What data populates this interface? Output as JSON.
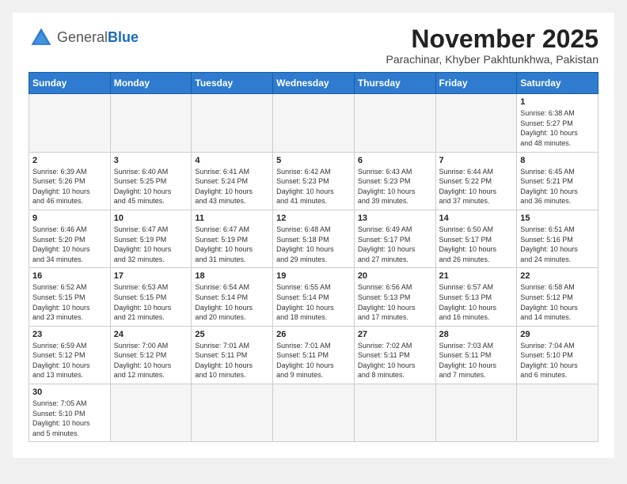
{
  "header": {
    "logo_general": "General",
    "logo_blue": "Blue",
    "month_title": "November 2025",
    "subtitle": "Parachinar, Khyber Pakhtunkhwa, Pakistan"
  },
  "weekdays": [
    "Sunday",
    "Monday",
    "Tuesday",
    "Wednesday",
    "Thursday",
    "Friday",
    "Saturday"
  ],
  "weeks": [
    [
      {
        "day": "",
        "info": ""
      },
      {
        "day": "",
        "info": ""
      },
      {
        "day": "",
        "info": ""
      },
      {
        "day": "",
        "info": ""
      },
      {
        "day": "",
        "info": ""
      },
      {
        "day": "",
        "info": ""
      },
      {
        "day": "1",
        "info": "Sunrise: 6:38 AM\nSunset: 5:27 PM\nDaylight: 10 hours\nand 48 minutes."
      }
    ],
    [
      {
        "day": "2",
        "info": "Sunrise: 6:39 AM\nSunset: 5:26 PM\nDaylight: 10 hours\nand 46 minutes."
      },
      {
        "day": "3",
        "info": "Sunrise: 6:40 AM\nSunset: 5:25 PM\nDaylight: 10 hours\nand 45 minutes."
      },
      {
        "day": "4",
        "info": "Sunrise: 6:41 AM\nSunset: 5:24 PM\nDaylight: 10 hours\nand 43 minutes."
      },
      {
        "day": "5",
        "info": "Sunrise: 6:42 AM\nSunset: 5:23 PM\nDaylight: 10 hours\nand 41 minutes."
      },
      {
        "day": "6",
        "info": "Sunrise: 6:43 AM\nSunset: 5:23 PM\nDaylight: 10 hours\nand 39 minutes."
      },
      {
        "day": "7",
        "info": "Sunrise: 6:44 AM\nSunset: 5:22 PM\nDaylight: 10 hours\nand 37 minutes."
      },
      {
        "day": "8",
        "info": "Sunrise: 6:45 AM\nSunset: 5:21 PM\nDaylight: 10 hours\nand 36 minutes."
      }
    ],
    [
      {
        "day": "9",
        "info": "Sunrise: 6:46 AM\nSunset: 5:20 PM\nDaylight: 10 hours\nand 34 minutes."
      },
      {
        "day": "10",
        "info": "Sunrise: 6:47 AM\nSunset: 5:19 PM\nDaylight: 10 hours\nand 32 minutes."
      },
      {
        "day": "11",
        "info": "Sunrise: 6:47 AM\nSunset: 5:19 PM\nDaylight: 10 hours\nand 31 minutes."
      },
      {
        "day": "12",
        "info": "Sunrise: 6:48 AM\nSunset: 5:18 PM\nDaylight: 10 hours\nand 29 minutes."
      },
      {
        "day": "13",
        "info": "Sunrise: 6:49 AM\nSunset: 5:17 PM\nDaylight: 10 hours\nand 27 minutes."
      },
      {
        "day": "14",
        "info": "Sunrise: 6:50 AM\nSunset: 5:17 PM\nDaylight: 10 hours\nand 26 minutes."
      },
      {
        "day": "15",
        "info": "Sunrise: 6:51 AM\nSunset: 5:16 PM\nDaylight: 10 hours\nand 24 minutes."
      }
    ],
    [
      {
        "day": "16",
        "info": "Sunrise: 6:52 AM\nSunset: 5:15 PM\nDaylight: 10 hours\nand 23 minutes."
      },
      {
        "day": "17",
        "info": "Sunrise: 6:53 AM\nSunset: 5:15 PM\nDaylight: 10 hours\nand 21 minutes."
      },
      {
        "day": "18",
        "info": "Sunrise: 6:54 AM\nSunset: 5:14 PM\nDaylight: 10 hours\nand 20 minutes."
      },
      {
        "day": "19",
        "info": "Sunrise: 6:55 AM\nSunset: 5:14 PM\nDaylight: 10 hours\nand 18 minutes."
      },
      {
        "day": "20",
        "info": "Sunrise: 6:56 AM\nSunset: 5:13 PM\nDaylight: 10 hours\nand 17 minutes."
      },
      {
        "day": "21",
        "info": "Sunrise: 6:57 AM\nSunset: 5:13 PM\nDaylight: 10 hours\nand 16 minutes."
      },
      {
        "day": "22",
        "info": "Sunrise: 6:58 AM\nSunset: 5:12 PM\nDaylight: 10 hours\nand 14 minutes."
      }
    ],
    [
      {
        "day": "23",
        "info": "Sunrise: 6:59 AM\nSunset: 5:12 PM\nDaylight: 10 hours\nand 13 minutes."
      },
      {
        "day": "24",
        "info": "Sunrise: 7:00 AM\nSunset: 5:12 PM\nDaylight: 10 hours\nand 12 minutes."
      },
      {
        "day": "25",
        "info": "Sunrise: 7:01 AM\nSunset: 5:11 PM\nDaylight: 10 hours\nand 10 minutes."
      },
      {
        "day": "26",
        "info": "Sunrise: 7:01 AM\nSunset: 5:11 PM\nDaylight: 10 hours\nand 9 minutes."
      },
      {
        "day": "27",
        "info": "Sunrise: 7:02 AM\nSunset: 5:11 PM\nDaylight: 10 hours\nand 8 minutes."
      },
      {
        "day": "28",
        "info": "Sunrise: 7:03 AM\nSunset: 5:11 PM\nDaylight: 10 hours\nand 7 minutes."
      },
      {
        "day": "29",
        "info": "Sunrise: 7:04 AM\nSunset: 5:10 PM\nDaylight: 10 hours\nand 6 minutes."
      }
    ],
    [
      {
        "day": "30",
        "info": "Sunrise: 7:05 AM\nSunset: 5:10 PM\nDaylight: 10 hours\nand 5 minutes."
      },
      {
        "day": "",
        "info": ""
      },
      {
        "day": "",
        "info": ""
      },
      {
        "day": "",
        "info": ""
      },
      {
        "day": "",
        "info": ""
      },
      {
        "day": "",
        "info": ""
      },
      {
        "day": "",
        "info": ""
      }
    ]
  ]
}
